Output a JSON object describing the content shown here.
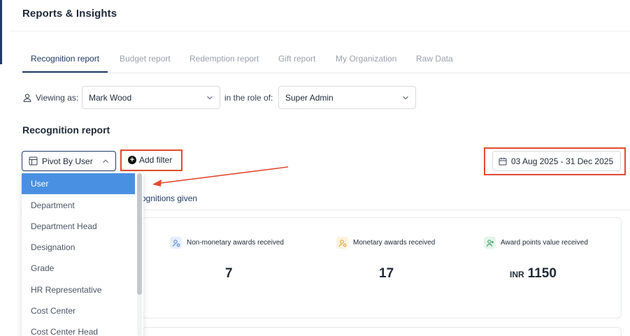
{
  "header": {
    "title": "Reports & Insights"
  },
  "tabs": [
    {
      "label": "Recognition report",
      "active": true
    },
    {
      "label": "Budget report",
      "active": false
    },
    {
      "label": "Redemption report",
      "active": false
    },
    {
      "label": "Gift report",
      "active": false
    },
    {
      "label": "My Organization",
      "active": false
    },
    {
      "label": "Raw Data",
      "active": false
    }
  ],
  "viewing": {
    "label": "Viewing as:",
    "user_value": "Mark Wood",
    "role_label": "in the role of:",
    "role_value": "Super Admin"
  },
  "section_title": "Recognition report",
  "toolbar": {
    "pivot_label": "Pivot By User",
    "add_filter_label": "Add filter",
    "date_range": "03 Aug 2025 - 31 Dec 2025"
  },
  "subtab_partial": "ognitions given",
  "dropdown": {
    "selected": "User",
    "options": [
      "User",
      "Department",
      "Department Head",
      "Designation",
      "Grade",
      "HR Representative",
      "Cost Center",
      "Cost Center Head"
    ]
  },
  "stats": [
    {
      "label": "Non-monetary awards received",
      "value": "7",
      "currency": "",
      "icon": "award-icon",
      "color": "#e7efff"
    },
    {
      "label": "Monetary awards received",
      "value": "17",
      "currency": "",
      "icon": "award-icon",
      "color": "#fff3dc"
    },
    {
      "label": "Award points value received",
      "value": "1150",
      "currency": "INR",
      "icon": "user-plus-icon",
      "color": "#e3f5ea"
    }
  ],
  "annotation_color": "#e04b2f"
}
